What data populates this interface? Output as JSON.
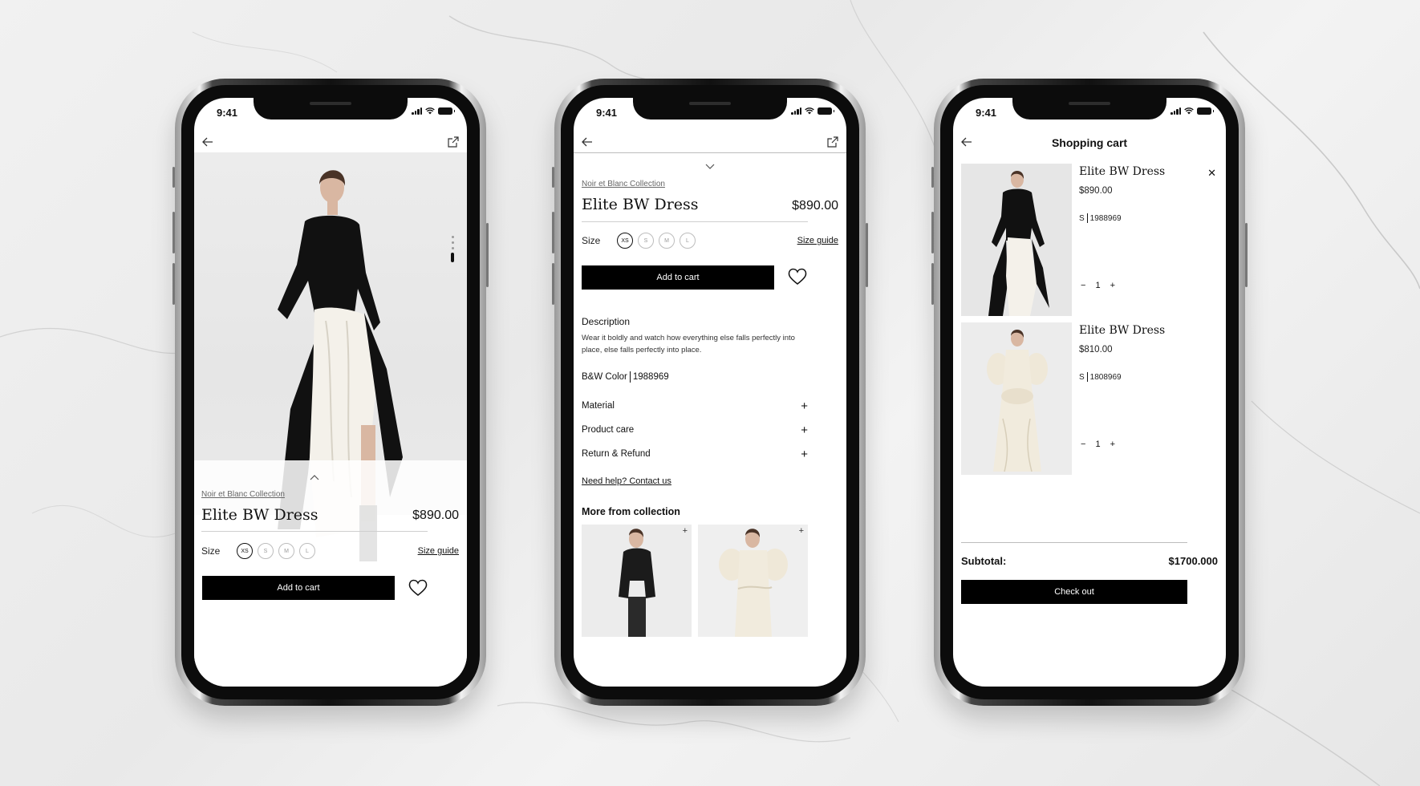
{
  "status_time": "9:41",
  "product": {
    "collection": "Noir et Blanc Collection",
    "name": "Elite BW Dress",
    "price": "$890.00",
    "size_label": "Size",
    "sizes": [
      "XS",
      "S",
      "M",
      "L"
    ],
    "selected_size": "XS",
    "size_guide": "Size guide",
    "add_to_cart": "Add to cart"
  },
  "details": {
    "description_label": "Description",
    "description_text": "Wear it boldly and watch how everything else falls perfectly into place, else falls perfectly into place.",
    "color_label": "B&W Color",
    "color_code": "1988969",
    "accordions": [
      "Material",
      "Product care",
      "Return & Refund"
    ],
    "help_link": "Need help? Contact us",
    "more_title": "More from collection"
  },
  "cart": {
    "title": "Shopping cart",
    "items": [
      {
        "name": "Elite BW Dress",
        "price": "$890.00",
        "size": "S",
        "code": "1988969",
        "qty": "1"
      },
      {
        "name": "Elite BW Dress",
        "price": "$810.00",
        "size": "S",
        "code": "1808969",
        "qty": "1"
      }
    ],
    "subtotal_label": "Subtotal:",
    "subtotal_value": "$1700.000",
    "checkout": "Check out"
  },
  "icons": {
    "back": "arrow-left-icon",
    "share": "external-link-icon",
    "wishlist": "heart-icon",
    "remove": "close-icon"
  }
}
